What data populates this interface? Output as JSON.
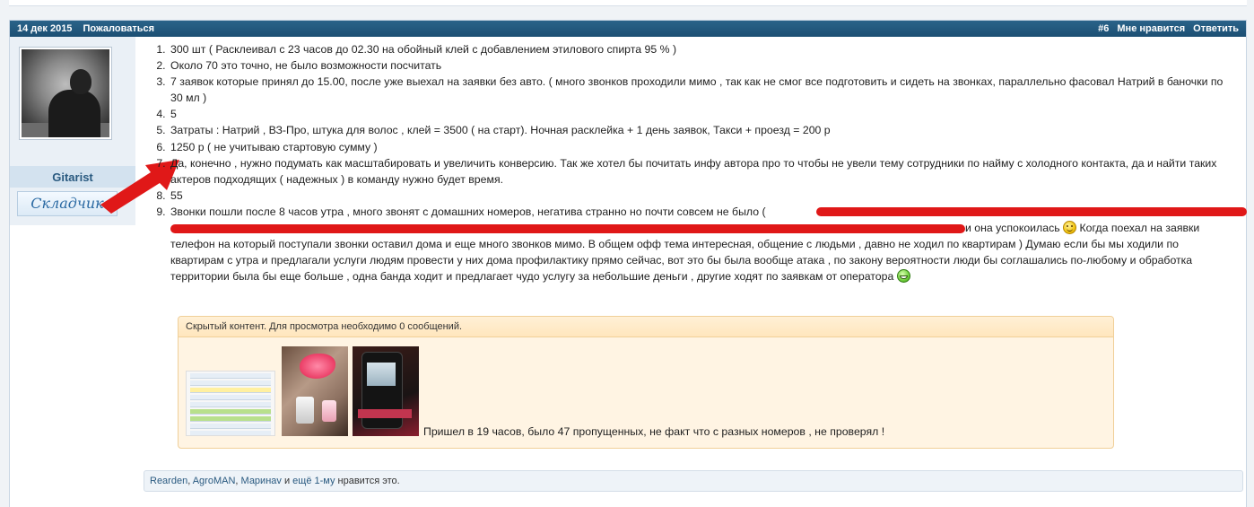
{
  "header": {
    "date": "14 дек 2015",
    "report": "Пожаловаться",
    "post_number": "#6",
    "like": "Мне нравится",
    "reply": "Ответить"
  },
  "author": {
    "username": "Gitarist",
    "usertitle": "Складчик"
  },
  "post": {
    "items": [
      "300 шт ( Расклеивал с 23 часов до 02.30 на обойный клей с добавлением этилового спирта 95 % )",
      "Около 70 это точно, не было возможности посчитать",
      "7 заявок которые принял до 15.00, после уже выехал на заявки без авто. ( много звонков проходили мимо , так как не смог все подготовить и сидеть на звонках, параллельно фасовал Натрий в баночки по 30 мл )",
      "5",
      "Затраты : Натрий , ВЗ-Про, штука для волос , клей = 3500 ( на старт). Ночная расклейка + 1 день заявок, Такси + проезд = 200 р",
      "1250 р ( не учитываю стартовую сумму )",
      "Да, конечно , нужно подумать как масштабировать и увеличить конверсию. Так же хотел бы почитать инфу автора про то чтобы не увели тему сотрудники по найму с холодного контакта, да и найти таких актеров подходящих ( надежных ) в команду нужно будет время.",
      "55",
      "Звонки пошли после 8 часов утра , много звонят с домашних номеров, негатива странно но почти совсем не было ("
    ],
    "cont_line1": "и она успокоилась",
    "cont_line1b": "Когда поехал на заявки",
    "cont_rest": "телефон на который поступали звонки оставил дома и еще много звонков мимо. В общем офф тема интересная, общение с людьми , давно не ходил по квартирам ) Думаю если бы мы ходили по квартирам с утра и предлагали услуги людям провести у них дома профилактику прямо сейчас, вот это бы была вообще атака , по закону вероятности люди бы соглашались по-любому и обработка территории была бы еще больше , одна банда ходит и предлагает чудо услугу за небольшие деньги , другие ходят по заявкам от оператора"
  },
  "hidden": {
    "header": "Скрытый контент. Для просмотра необходимо 0 сообщений.",
    "caption": "Пришел в 19 часов, было 47 пропущенных, не факт что с разных номеров , не проверял !"
  },
  "likes": {
    "user1": "Rearden",
    "sep1": ", ",
    "user2": "AgroMAN",
    "sep2": ", ",
    "user3": "Маринаv",
    "and": " и ",
    "more": "ещё 1-му",
    "suffix": " нравится это."
  },
  "colors": {
    "header_bg": "#1c4f73",
    "redaction": "#e01818",
    "hidden_bg": "#fff4e3"
  }
}
